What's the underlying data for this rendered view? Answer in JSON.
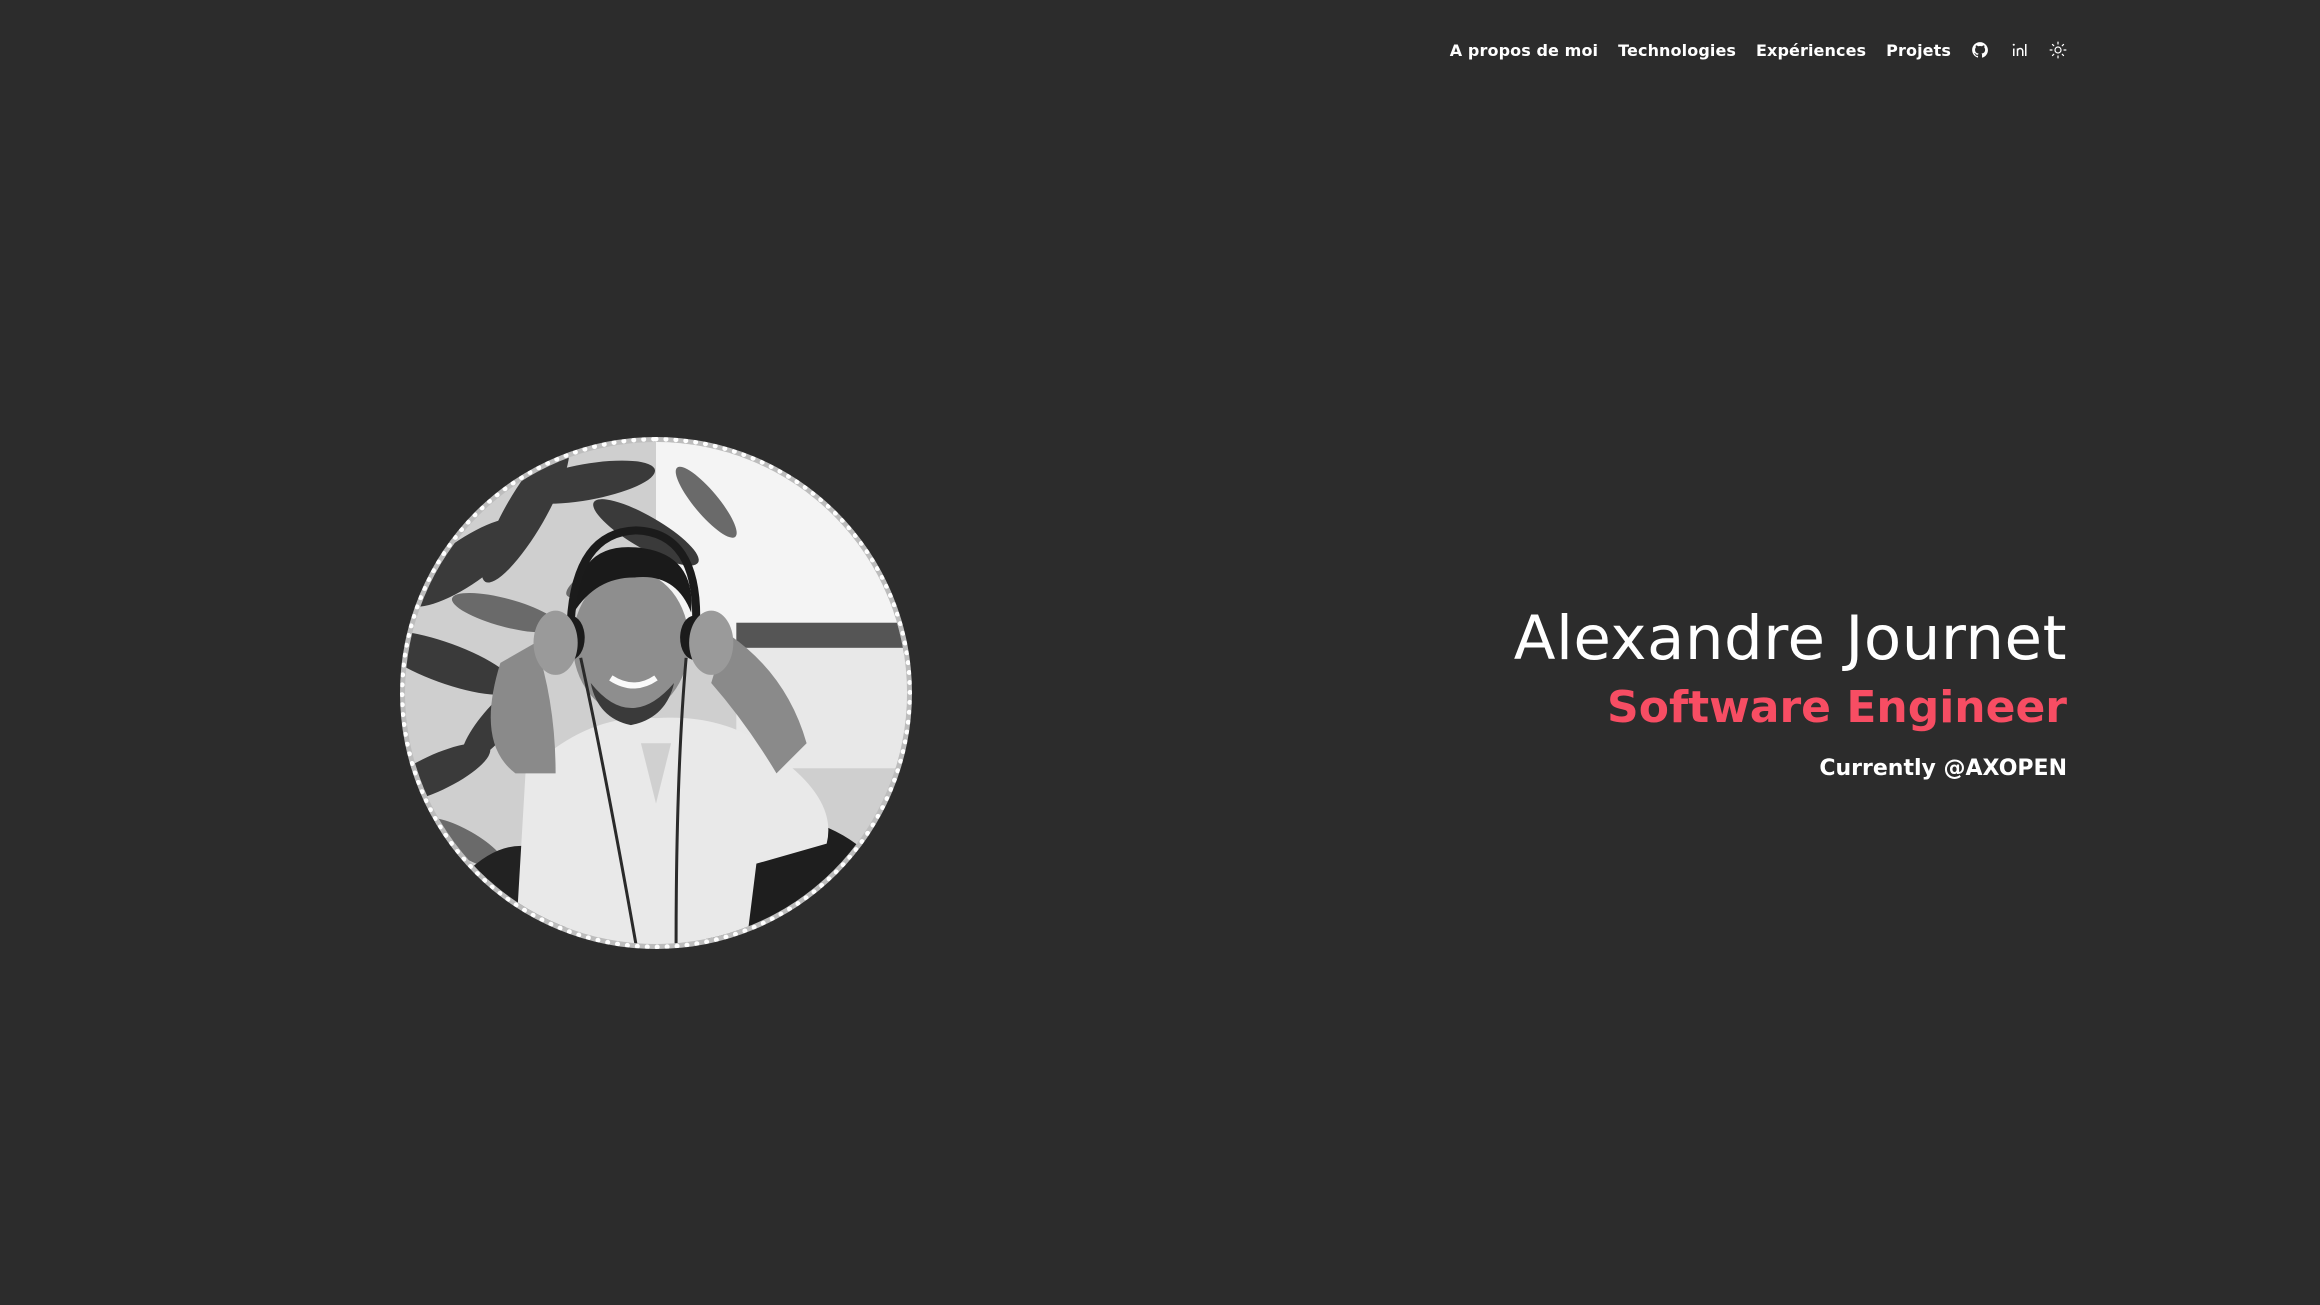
{
  "nav": {
    "items": [
      {
        "label": "A propos de moi"
      },
      {
        "label": "Technologies"
      },
      {
        "label": "Expériences"
      },
      {
        "label": "Projets"
      }
    ],
    "icons": [
      "github-icon",
      "linkedin-icon",
      "sun-icon"
    ]
  },
  "hero": {
    "name": "Alexandre Journet",
    "role": "Software Engineer",
    "current": "Currently @AXOPEN"
  },
  "colors": {
    "background": "#2c2c2c",
    "text": "#ffffff",
    "accent": "#f74d63"
  }
}
